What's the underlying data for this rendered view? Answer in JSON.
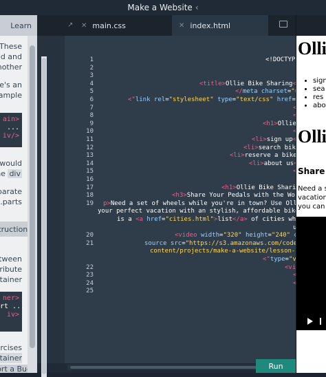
{
  "window": {
    "title": "Make a Website",
    "title_chevron": "‹"
  },
  "left_panel": {
    "learn_tab": "Learn",
    "text_lines": [
      "These",
      "ded and",
      "nother",
      "re's an",
      "ample"
    ],
    "code_block_1": [
      "ain>",
      "...",
      "iv/>"
    ],
    "text_lines_2": [
      "would",
      "the"
    ],
    "div_chip": "div",
    "text_lines_3": [
      "parate",
      ".parts"
    ],
    "section_label": "structions",
    "text_lines_4": [
      "between",
      "tribute",
      "ntainer"
    ],
    "code_block_2": [
      "ner>",
      "rt ...",
      "iv>"
    ],
    "text_lines_5": [
      "ercises",
      "tainer"
    ],
    "report_bug": "ort a Bug"
  },
  "editor": {
    "tabs": [
      {
        "label": "main.css",
        "active": false
      },
      {
        "label": "index.html",
        "active": true
      }
    ],
    "expand_icon": "↗",
    "folder_icon": "folder-icon",
    "line_numbers": [
      "1",
      "2",
      "3",
      "4",
      "5",
      "6",
      "7",
      "8",
      "9",
      "10",
      "11",
      "12",
      "13",
      "14",
      "15",
      "16",
      "17",
      "18",
      "19",
      "",
      "",
      "20",
      "21",
      "",
      "",
      "22",
      "23",
      "24",
      "25"
    ],
    "code_lines": [
      {
        "n": "1",
        "indent": 280,
        "segs": [
          [
            "text",
            "<!DOCTYPE html"
          ]
        ]
      },
      {
        "n": "2",
        "indent": 324,
        "segs": [
          [
            "tag",
            "<htm"
          ]
        ]
      },
      {
        "n": "3",
        "indent": 324,
        "segs": [
          [
            "tag",
            "<hea"
          ]
        ]
      },
      {
        "n": "4",
        "indent": 184,
        "segs": [
          [
            "tag",
            "<title>"
          ],
          [
            "text",
            "Ollie Bike Sharing"
          ],
          [
            "tag",
            "</title>"
          ]
        ]
      },
      {
        "n": "5",
        "indent": 236,
        "segs": [
          [
            "tag",
            "</"
          ],
          [
            "attr",
            "meta charset"
          ],
          [
            "text",
            "="
          ],
          [
            "str",
            "\"utf-8"
          ]
        ]
      },
      {
        "n": "6",
        "indent": 80,
        "segs": [
          [
            "tag",
            "<\""
          ],
          [
            "attr",
            "link rel"
          ],
          [
            "text",
            "="
          ],
          [
            "str",
            "\"stylesheet\""
          ],
          [
            "attr",
            " type"
          ],
          [
            "text",
            "="
          ],
          [
            "str",
            "\"text/css\""
          ],
          [
            "attr",
            " href"
          ],
          [
            "text",
            "="
          ],
          [
            "str",
            "\"main.css"
          ]
        ]
      },
      {
        "n": "7",
        "indent": 320,
        "segs": [
          [
            "tag",
            "<head"
          ]
        ]
      },
      {
        "n": "8",
        "indent": 320,
        "segs": [
          [
            "tag",
            "<bod"
          ]
        ]
      },
      {
        "n": "9",
        "indent": 276,
        "segs": [
          [
            "tag",
            "<h1>"
          ],
          [
            "text",
            "Ollie"
          ],
          [
            "tag",
            "</h1>"
          ]
        ]
      },
      {
        "n": "10",
        "indent": 320,
        "segs": [
          [
            "tag",
            "<ul>"
          ]
        ]
      },
      {
        "n": "11",
        "indent": 260,
        "segs": [
          [
            "tag",
            "<li>"
          ],
          [
            "text",
            "sign up"
          ],
          [
            "tag",
            "</li>"
          ]
        ]
      },
      {
        "n": "12",
        "indent": 248,
        "segs": [
          [
            "tag",
            "<li>"
          ],
          [
            "text",
            "search bikes"
          ],
          [
            "tag",
            "</li>"
          ]
        ]
      },
      {
        "n": "13",
        "indent": 228,
        "segs": [
          [
            "tag",
            "<li>"
          ],
          [
            "text",
            "reserve a bike"
          ],
          [
            "tag",
            "</li>"
          ]
        ]
      },
      {
        "n": "14",
        "indent": 256,
        "segs": [
          [
            "tag",
            "<li>"
          ],
          [
            "text",
            "about us"
          ],
          [
            "tag",
            "</li>"
          ]
        ]
      },
      {
        "n": "15",
        "indent": 320,
        "segs": [
          [
            "tag",
            "<ul>"
          ]
        ]
      },
      {
        "n": "16",
        "indent": 0,
        "segs": []
      },
      {
        "n": "17",
        "indent": 216,
        "segs": [
          [
            "tag",
            "<h1>"
          ],
          [
            "text",
            "Ollie Bike Sharing"
          ],
          [
            "tag",
            "</h"
          ]
        ]
      },
      {
        "n": "18",
        "indent": 144,
        "segs": [
          [
            "tag",
            "<h3>"
          ],
          [
            "text",
            "Share Your Pedals with the World."
          ],
          [
            "tag",
            "</h"
          ]
        ]
      },
      {
        "n": "19",
        "indent": 44,
        "segs": [
          [
            "tag",
            "p>"
          ],
          [
            "text",
            "Need a set of wheels while you're in town? Use Ollie to pair"
          ]
        ]
      },
      {
        "n": "",
        "indent": 36,
        "segs": [
          [
            "text",
            "your perfect vacation with an stylish, affordable bike rental. He"
          ]
        ]
      },
      {
        "n": "",
        "indent": 64,
        "segs": [
          [
            "text",
            "is a "
          ],
          [
            "tag",
            "<a "
          ],
          [
            "attr",
            "href"
          ],
          [
            "text",
            "="
          ],
          [
            "str",
            "\"cities.html\""
          ],
          [
            "tag",
            ">"
          ],
          [
            "text",
            "list"
          ],
          [
            "tag",
            "</a>"
          ],
          [
            "text",
            " of cities where you can fi"
          ]
        ]
      },
      {
        "n": "",
        "indent": 320,
        "segs": [
          [
            "text",
            "us."
          ],
          [
            "tag",
            "<"
          ]
        ]
      },
      {
        "n": "20",
        "indent": 148,
        "segs": [
          [
            "tag",
            "<video "
          ],
          [
            "attr",
            "width"
          ],
          [
            "text",
            "="
          ],
          [
            "str",
            "\"320\""
          ],
          [
            "attr",
            " height"
          ],
          [
            "text",
            "="
          ],
          [
            "str",
            "\"240\""
          ],
          [
            "attr",
            " controls"
          ],
          [
            "tag",
            ">"
          ]
        ]
      },
      {
        "n": "21",
        "indent": 104,
        "segs": [
          [
            "attr",
            "source src"
          ],
          [
            "text",
            "="
          ],
          [
            "str",
            "\"https://s3.amazonaws.com/codecademy-"
          ],
          [
            "tag",
            ">"
          ]
        ]
      },
      {
        "n": "",
        "indent": 112,
        "segs": [
          [
            "str",
            "content/projects/make-a-website/lesson-1/ollie.mp"
          ]
        ]
      },
      {
        "n": "",
        "indent": 276,
        "segs": [
          [
            "tag",
            "<\""
          ],
          [
            "attr",
            "type"
          ],
          [
            "text",
            "="
          ],
          [
            "str",
            "\"video/m"
          ]
        ]
      },
      {
        "n": "22",
        "indent": 308,
        "segs": [
          [
            "tag",
            "<video/>"
          ]
        ]
      },
      {
        "n": "23",
        "indent": 320,
        "segs": [
          [
            "tag",
            "<body"
          ]
        ]
      },
      {
        "n": "24",
        "indent": 320,
        "segs": [
          [
            "tag",
            "<html"
          ]
        ]
      },
      {
        "n": "25",
        "indent": 0,
        "segs": []
      }
    ],
    "run_label": "Run"
  },
  "preview": {
    "h1_a": "Olli",
    "list": [
      "sign",
      "sea",
      "res",
      "abo"
    ],
    "h1_b": "Olli",
    "h3": "Share Y",
    "p_lines": [
      "Need a s",
      "vacation",
      "you can t"
    ]
  },
  "colors": {
    "tag": "#f25c8c",
    "string": "#ffd75e",
    "attribute": "#9ad0ff",
    "text": "#ffffff",
    "run_button": "#1f8a7b"
  }
}
